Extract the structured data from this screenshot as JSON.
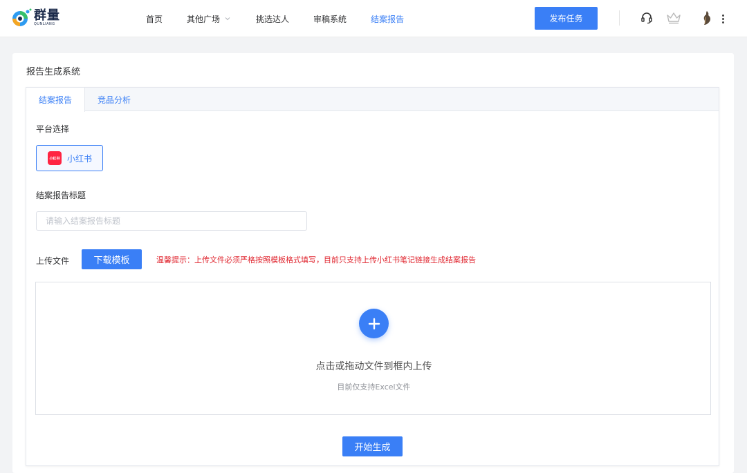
{
  "brand": {
    "name_cn": "群量",
    "name_en": "QUNLIANG",
    "colors": {
      "accent": "#3a7ff6",
      "warning": "#e0262f",
      "xiaohongshu": "#ff2442"
    }
  },
  "nav": {
    "items": [
      {
        "label": "首页",
        "active": false
      },
      {
        "label": "其他广场",
        "active": false,
        "has_dropdown": true
      },
      {
        "label": "挑选达人",
        "active": false
      },
      {
        "label": "审稿系统",
        "active": false
      },
      {
        "label": "结案报告",
        "active": true
      }
    ],
    "publish_label": "发布任务",
    "icons": [
      "headset-icon",
      "crown-icon",
      "avatar-icon",
      "more-vertical-icon"
    ]
  },
  "page": {
    "title": "报告生成系统"
  },
  "tabs": [
    {
      "label": "结案报告",
      "active": true
    },
    {
      "label": "竞品分析",
      "active": false
    }
  ],
  "form": {
    "platform_label": "平台选择",
    "platform": {
      "name": "小红书",
      "logo_text": "小红书",
      "icon": "xiaohongshu-logo-icon"
    },
    "title_label": "结案报告标题",
    "title_value": "",
    "title_placeholder": "请输入结案报告标题",
    "upload_label": "上传文件",
    "download_template_label": "下载模板",
    "tip": "温馨提示：上传文件必须严格按照模板格式填写，目前只支持上传小红书笔记链接生成结案报告",
    "dropzone": {
      "icon": "plus-icon",
      "text": "点击或拖动文件到框内上传",
      "subtext": "目前仅支持Excel文件"
    },
    "start_label": "开始生成"
  }
}
